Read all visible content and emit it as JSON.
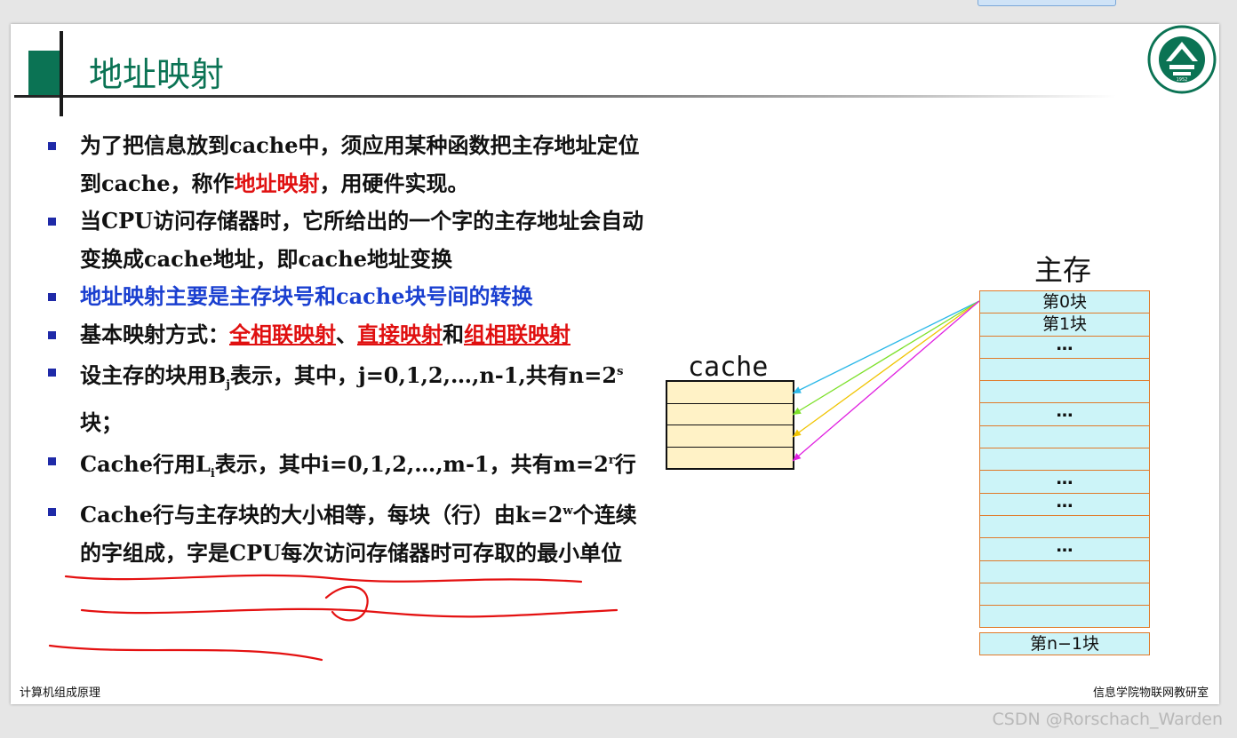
{
  "slide": {
    "title": "地址映射",
    "footer_left": "计算机组成原理",
    "footer_right": "信息学院物联网教研室"
  },
  "bullets": [
    {
      "parts": [
        "为了把信息放到cache中，须应用某种函数把主存地址定位到cache，称作",
        "地址映射",
        "，用硬件实现。"
      ]
    },
    {
      "text": "当CPU访问存储器时，它所给出的一个字的主存地址会自动变换成cache地址，即cache地址变换"
    },
    {
      "text": "地址映射主要是主存块号和cache块号间的转换"
    },
    {
      "parts": [
        "基本映射方式：",
        "全相联映射",
        "、",
        "直接映射",
        "和",
        "组相联映射"
      ]
    },
    {
      "parts": [
        "设主存的块用B",
        "j",
        "表示，其中，j=0,1,2,…,n-1,共有n=2",
        "s",
        "块；"
      ]
    },
    {
      "parts": [
        "Cache行用L",
        "i",
        "表示，其中i=0,1,2,…,m-1，共有m=2",
        "r",
        "行"
      ]
    },
    {
      "parts": [
        "Cache行与主存块的大小相等，每块（行）由k=2",
        "w",
        "个连续的字组成，字是CPU每次访问存储器时可存取的最小单位"
      ]
    }
  ],
  "diagram": {
    "cache_label": "cache",
    "cache_rows": 4,
    "memory_label": "主存",
    "memory_rows": [
      "第0块",
      "第1块",
      "…",
      "",
      "",
      "…",
      "",
      "",
      "…",
      "…",
      "",
      "…",
      "",
      "",
      ""
    ],
    "memory_last": "第n−1块",
    "arrow_colors": [
      "#2bb8e8",
      "#7de02a",
      "#f0c400",
      "#e020e0"
    ]
  },
  "logo": {
    "text": "BEIJING FORESTRY UNIVERSITY",
    "year": "1952"
  },
  "watermark": "CSDN @Rorschach_Warden"
}
